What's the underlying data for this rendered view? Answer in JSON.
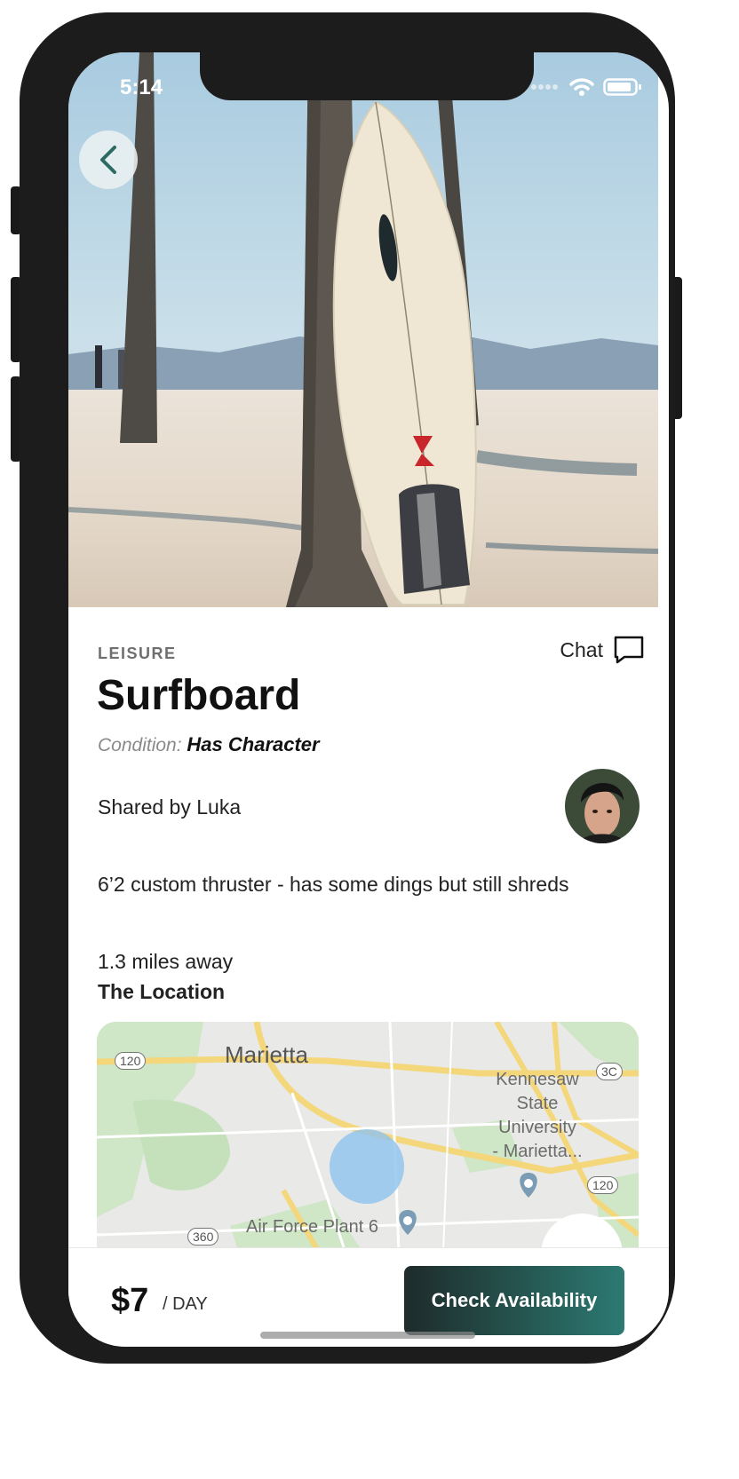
{
  "status": {
    "time": "5:14"
  },
  "item": {
    "category": "LEISURE",
    "title": "Surfboard",
    "condition_label": "Condition:",
    "condition_value": "Has Character",
    "shared_by_prefix": "Shared by",
    "owner": "Luka",
    "description": "6’2 custom thruster - has some dings but still shreds",
    "distance_value": "1.3",
    "distance_suffix": "miles away",
    "location_heading": "The Location"
  },
  "chat": {
    "label": "Chat"
  },
  "map": {
    "city": "Marietta",
    "university": [
      "Kennesaw",
      "State",
      "University",
      "- Marietta..."
    ],
    "poi": "Air Force Plant 6",
    "routes": [
      "120",
      "3C",
      "120",
      "360"
    ]
  },
  "footer": {
    "price": "$7",
    "per": "/ DAY",
    "cta": "Check Availability"
  },
  "colors": {
    "accent_start": "#1e2b2a",
    "accent_end": "#2c7a72",
    "back_arrow": "#2c6b63"
  }
}
